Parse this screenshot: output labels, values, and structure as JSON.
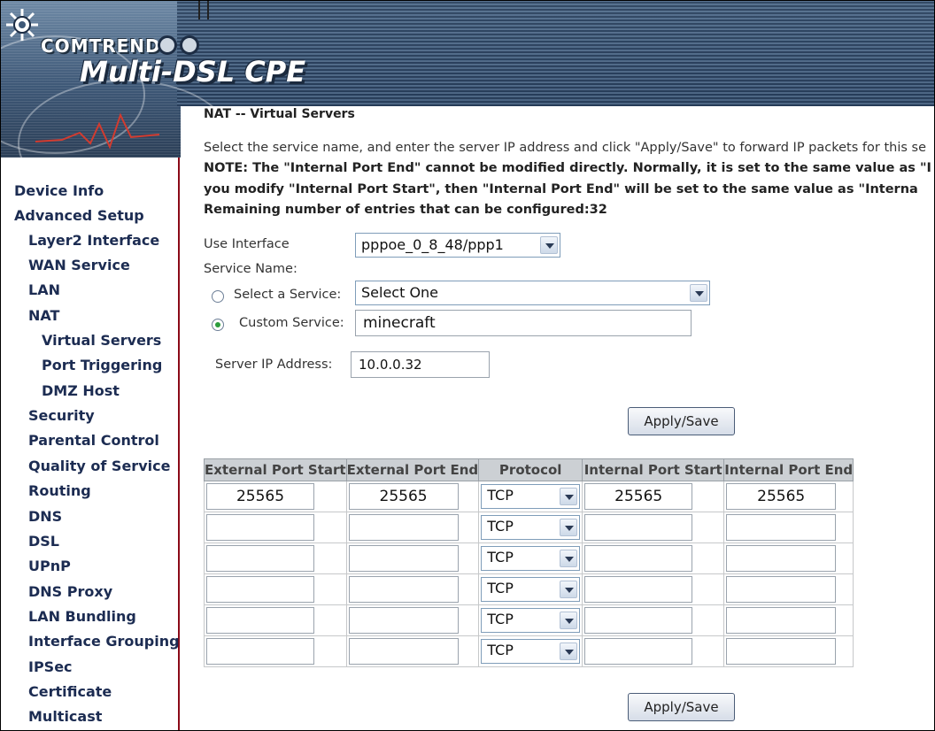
{
  "brand": {
    "company": "COMTREND",
    "product": "Multi-DSL CPE"
  },
  "sidebar": {
    "items": [
      {
        "label": "Device Info"
      },
      {
        "label": "Advanced Setup"
      },
      {
        "label": "Layer2 Interface"
      },
      {
        "label": "WAN Service"
      },
      {
        "label": "LAN"
      },
      {
        "label": "NAT"
      },
      {
        "label": "Virtual Servers"
      },
      {
        "label": "Port Triggering"
      },
      {
        "label": "DMZ Host"
      },
      {
        "label": "Security"
      },
      {
        "label": "Parental Control"
      },
      {
        "label": "Quality of Service"
      },
      {
        "label": "Routing"
      },
      {
        "label": "DNS"
      },
      {
        "label": "DSL"
      },
      {
        "label": "UPnP"
      },
      {
        "label": "DNS Proxy"
      },
      {
        "label": "LAN Bundling"
      },
      {
        "label": "Interface Grouping"
      },
      {
        "label": "IPSec"
      },
      {
        "label": "Certificate"
      },
      {
        "label": "Multicast"
      }
    ]
  },
  "page": {
    "title": "NAT -- Virtual Servers",
    "intro": "Select the service name, and enter the server IP address and click \"Apply/Save\" to forward IP packets for this se",
    "note1": "NOTE: The \"Internal Port End\" cannot be modified directly. Normally, it is set to the same value as \"I",
    "note2": "you modify \"Internal Port Start\", then \"Internal Port End\" will be set to the same value as \"Interna",
    "remaining": "Remaining number of entries that can be configured:32"
  },
  "form": {
    "use_interface_label": "Use Interface",
    "use_interface_value": "pppoe_0_8_48/ppp1",
    "service_name_label": "Service Name:",
    "select_service_label": "Select a Service:",
    "select_service_value": "Select One",
    "custom_service_label": "Custom Service:",
    "custom_service_value": "minecraft",
    "custom_selected": true,
    "server_ip_label": "Server IP Address:",
    "server_ip_value": "10.0.0.32",
    "apply_label": "Apply/Save"
  },
  "table": {
    "headers": [
      "External Port Start",
      "External Port End",
      "Protocol",
      "Internal Port Start",
      "Internal Port End"
    ],
    "rows": [
      {
        "ext_start": "25565",
        "ext_end": "25565",
        "protocol": "TCP",
        "int_start": "25565",
        "int_end": "25565"
      },
      {
        "ext_start": "",
        "ext_end": "",
        "protocol": "TCP",
        "int_start": "",
        "int_end": ""
      },
      {
        "ext_start": "",
        "ext_end": "",
        "protocol": "TCP",
        "int_start": "",
        "int_end": ""
      },
      {
        "ext_start": "",
        "ext_end": "",
        "protocol": "TCP",
        "int_start": "",
        "int_end": ""
      },
      {
        "ext_start": "",
        "ext_end": "",
        "protocol": "TCP",
        "int_start": "",
        "int_end": ""
      },
      {
        "ext_start": "",
        "ext_end": "",
        "protocol": "TCP",
        "int_start": "",
        "int_end": ""
      }
    ]
  },
  "colors": {
    "sidebar_text": "#1c2c52",
    "sidebar_border": "#8b0a18",
    "header_bg": "#3e5877"
  }
}
